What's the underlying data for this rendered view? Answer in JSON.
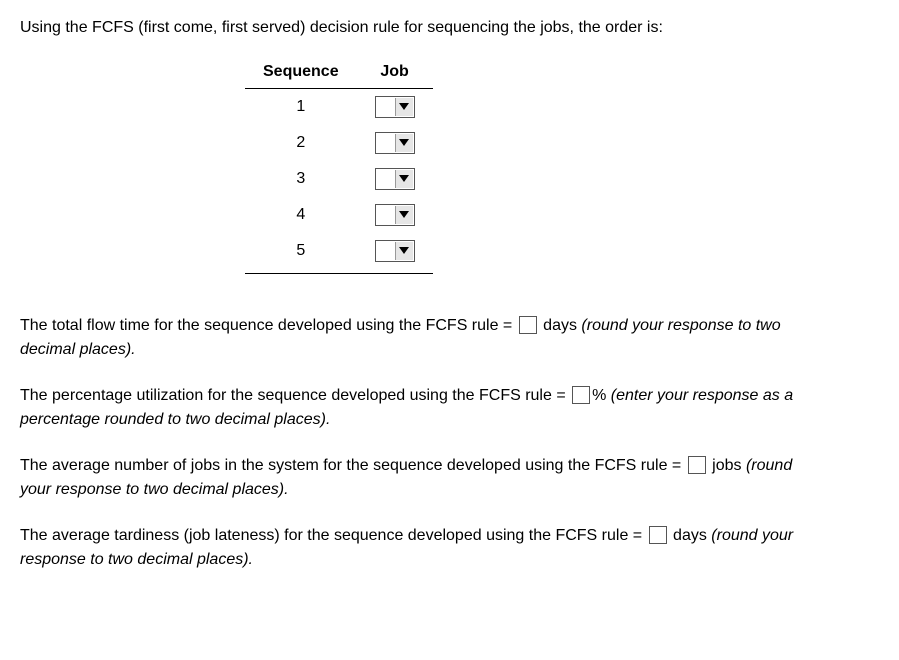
{
  "intro": "Using the FCFS (first come, first served) decision rule for sequencing the jobs, the order is:",
  "table": {
    "headers": {
      "sequence": "Sequence",
      "job": "Job"
    },
    "rows": [
      {
        "seq": "1"
      },
      {
        "seq": "2"
      },
      {
        "seq": "3"
      },
      {
        "seq": "4"
      },
      {
        "seq": "5"
      }
    ]
  },
  "q1": {
    "pre": "The total flow time for the sequence developed using the FCFS rule = ",
    "unit": " days ",
    "hint": "(round your response to two decimal places)."
  },
  "q2": {
    "pre": "The percentage utilization for the sequence developed using the FCFS rule = ",
    "unit": "% ",
    "hint": "(enter your response as a percentage rounded to two decimal places)."
  },
  "q3": {
    "pre": "The average number of jobs in the system for the sequence developed using the FCFS rule = ",
    "unit": " jobs ",
    "hint": "(round your response to two decimal places)."
  },
  "q4": {
    "pre": "The average tardiness (job lateness) for the sequence developed using the FCFS rule = ",
    "unit": " days ",
    "hint": "(round your response to two decimal places)."
  }
}
